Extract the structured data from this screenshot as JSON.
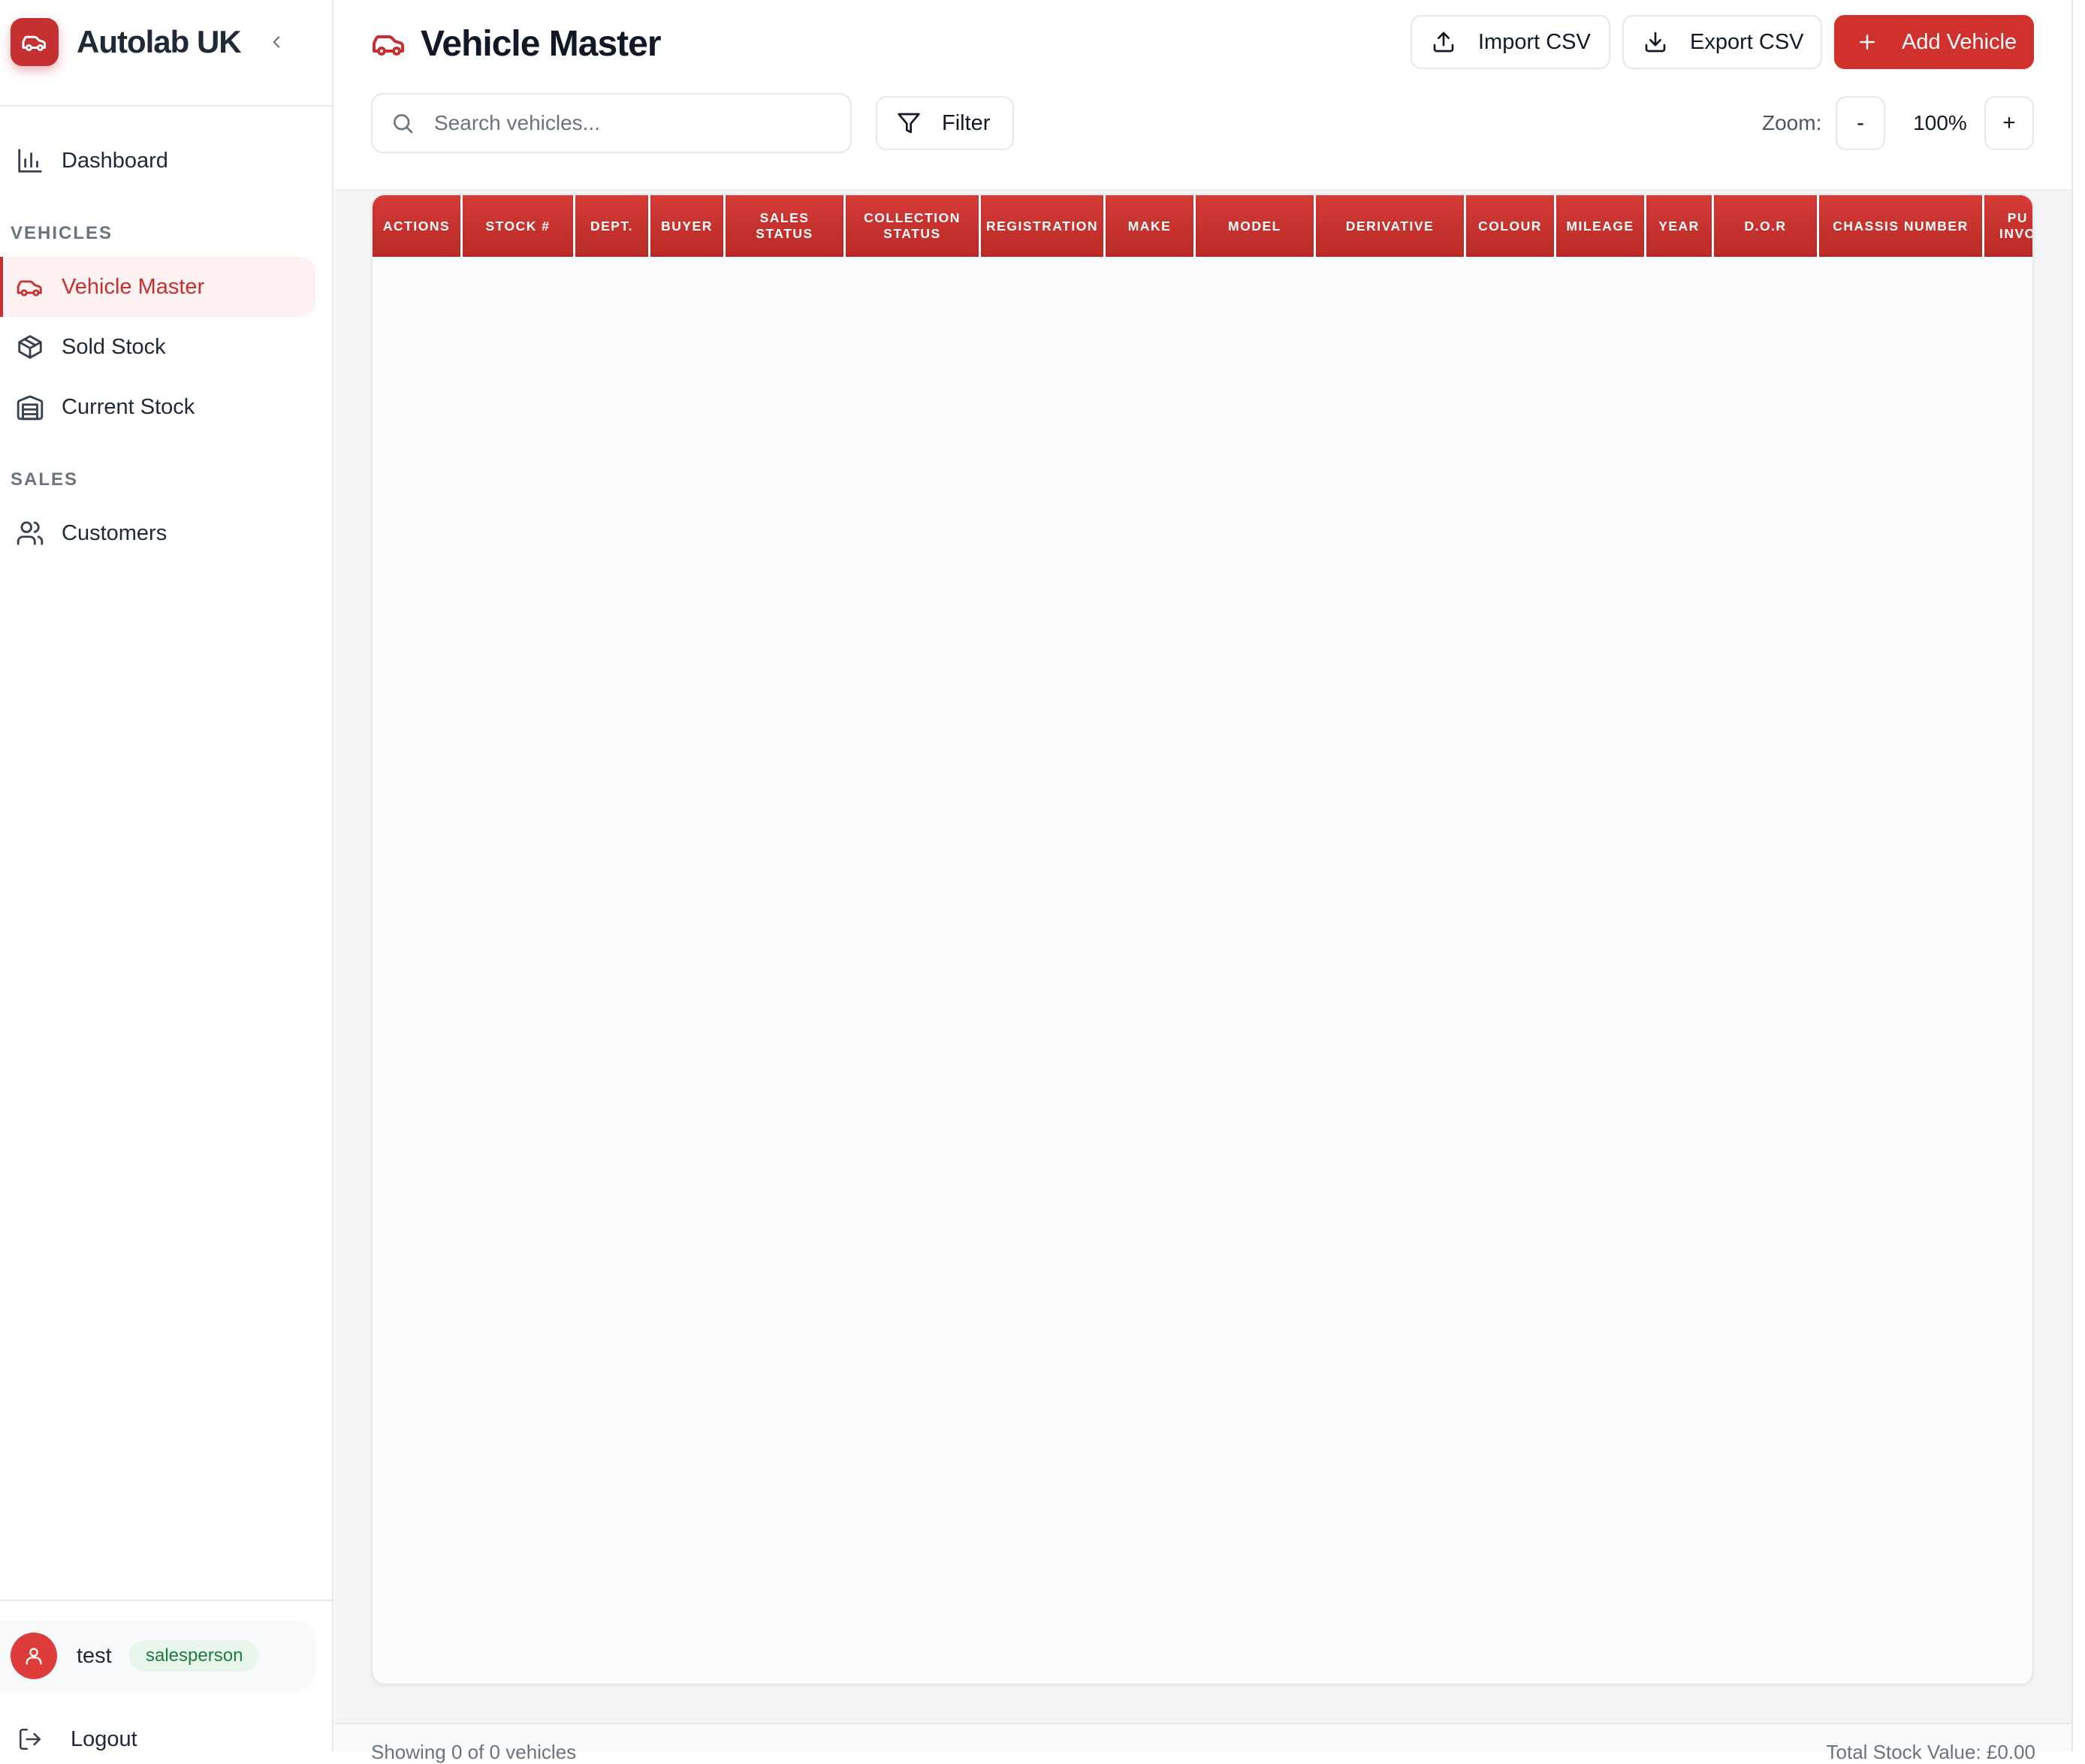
{
  "app": {
    "brand": "Autolab UK"
  },
  "sidebar": {
    "dashboard_label": "Dashboard",
    "sections": [
      {
        "label": "VEHICLES",
        "items": [
          "Vehicle Master",
          "Sold Stock",
          "Current Stock"
        ]
      },
      {
        "label": "SALES",
        "items": [
          "Customers"
        ]
      }
    ],
    "active_item": "Vehicle Master",
    "user": {
      "name": "test",
      "role": "salesperson"
    },
    "logout_label": "Logout"
  },
  "header": {
    "title": "Vehicle Master",
    "import_label": "Import CSV",
    "export_label": "Export CSV",
    "add_label": "Add Vehicle"
  },
  "toolbar": {
    "search_placeholder": "Search vehicles...",
    "filter_label": "Filter",
    "zoom_label": "Zoom:",
    "zoom_minus": "-",
    "zoom_value": "100%",
    "zoom_plus": "+"
  },
  "table": {
    "columns": [
      "ACTIONS",
      "STOCK #",
      "DEPT.",
      "BUYER",
      "SALES\nSTATUS",
      "COLLECTION\nSTATUS",
      "REGISTRATION",
      "MAKE",
      "MODEL",
      "DERIVATIVE",
      "COLOUR",
      "MILEAGE",
      "YEAR",
      "D.O.R",
      "CHASSIS NUMBER",
      "PU\nINVO"
    ],
    "rows": []
  },
  "footer": {
    "showing": "Showing 0 of 0 vehicles",
    "total_stock_value": "Total Stock Value: £0.00"
  },
  "colors": {
    "accent": "#d0312d",
    "active_bg": "#fdf2f1",
    "role_badge_bg": "#e8f6ec",
    "role_badge_text": "#1f7a3f"
  },
  "icons": {
    "brand": "car-icon",
    "collapse": "chevron-left-icon",
    "dashboard": "bar-chart-icon",
    "vehicle_master": "car-icon",
    "sold_stock": "box-icon",
    "current_stock": "warehouse-icon",
    "customers": "users-icon",
    "avatar": "user-icon",
    "logout": "logout-icon",
    "import": "upload-icon",
    "export": "download-icon",
    "add": "plus-icon",
    "search": "search-icon",
    "filter": "filter-icon"
  }
}
